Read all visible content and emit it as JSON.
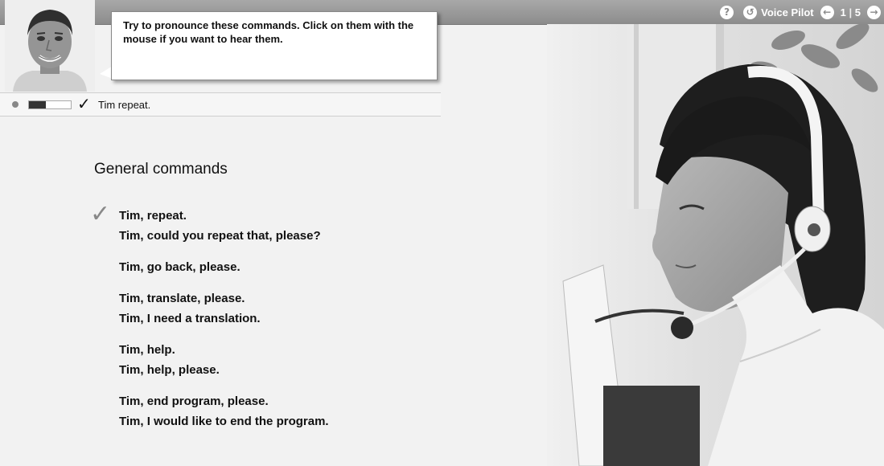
{
  "topbar": {
    "help_icon": "help-icon",
    "voice_pilot_label": "Voice Pilot",
    "voice_pilot_icon": "voice-pilot-icon",
    "page_current": "1",
    "page_separator": "|",
    "page_total": "5",
    "prev_icon": "arrow-left-icon",
    "next_icon": "arrow-right-icon"
  },
  "tutor": {
    "instruction": "Try to pronounce these commands. Click on them with the mouse if you want to hear them."
  },
  "status": {
    "recognized_text": "Tim repeat.",
    "level": 0.4
  },
  "commands": {
    "title": "General commands",
    "groups": [
      [
        "Tim, repeat.",
        "Tim, could you repeat that, please?"
      ],
      [
        "Tim, go back, please."
      ],
      [
        "Tim, translate, please.",
        "Tim, I need a translation."
      ],
      [
        "Tim, help.",
        "Tim, help, please."
      ],
      [
        "Tim, end program, please.",
        "Tim, I would like to end the program."
      ]
    ]
  },
  "colors": {
    "topbar": "#9a9a9a",
    "background": "#f2f2f2"
  }
}
